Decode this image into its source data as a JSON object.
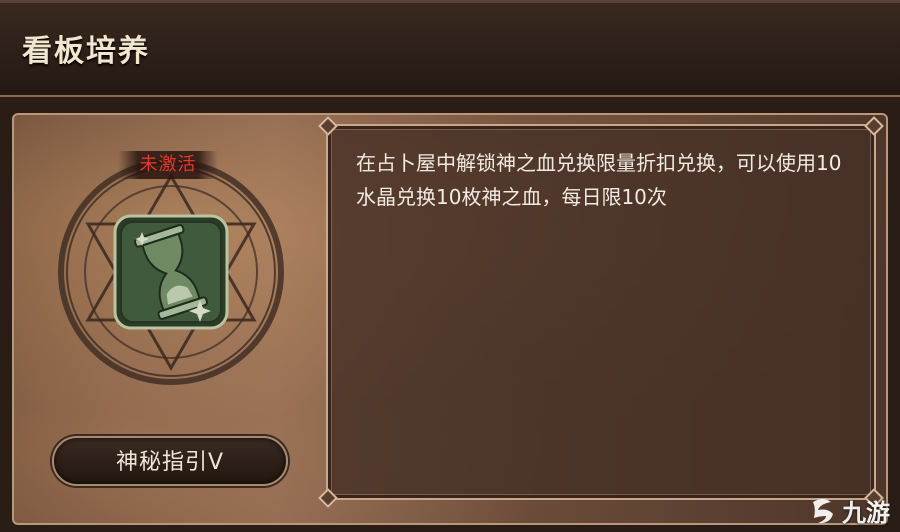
{
  "header": {
    "title": "看板培养"
  },
  "card": {
    "status": "未激活",
    "name": "神秘指引Ⅴ",
    "description": "在占卜屋中解锁神之血兑换限量折扣兑换，可以使用10水晶兑换10枚神之血，每日限10次"
  },
  "watermark": {
    "text": "九游"
  },
  "icons": {
    "seal": "hexagram-seal-icon",
    "hourglass": "hourglass-icon"
  },
  "colors": {
    "status_text": "#e23a2e",
    "emblem_green": "#3f5a3c",
    "frame_gold": "#c9a98a"
  }
}
